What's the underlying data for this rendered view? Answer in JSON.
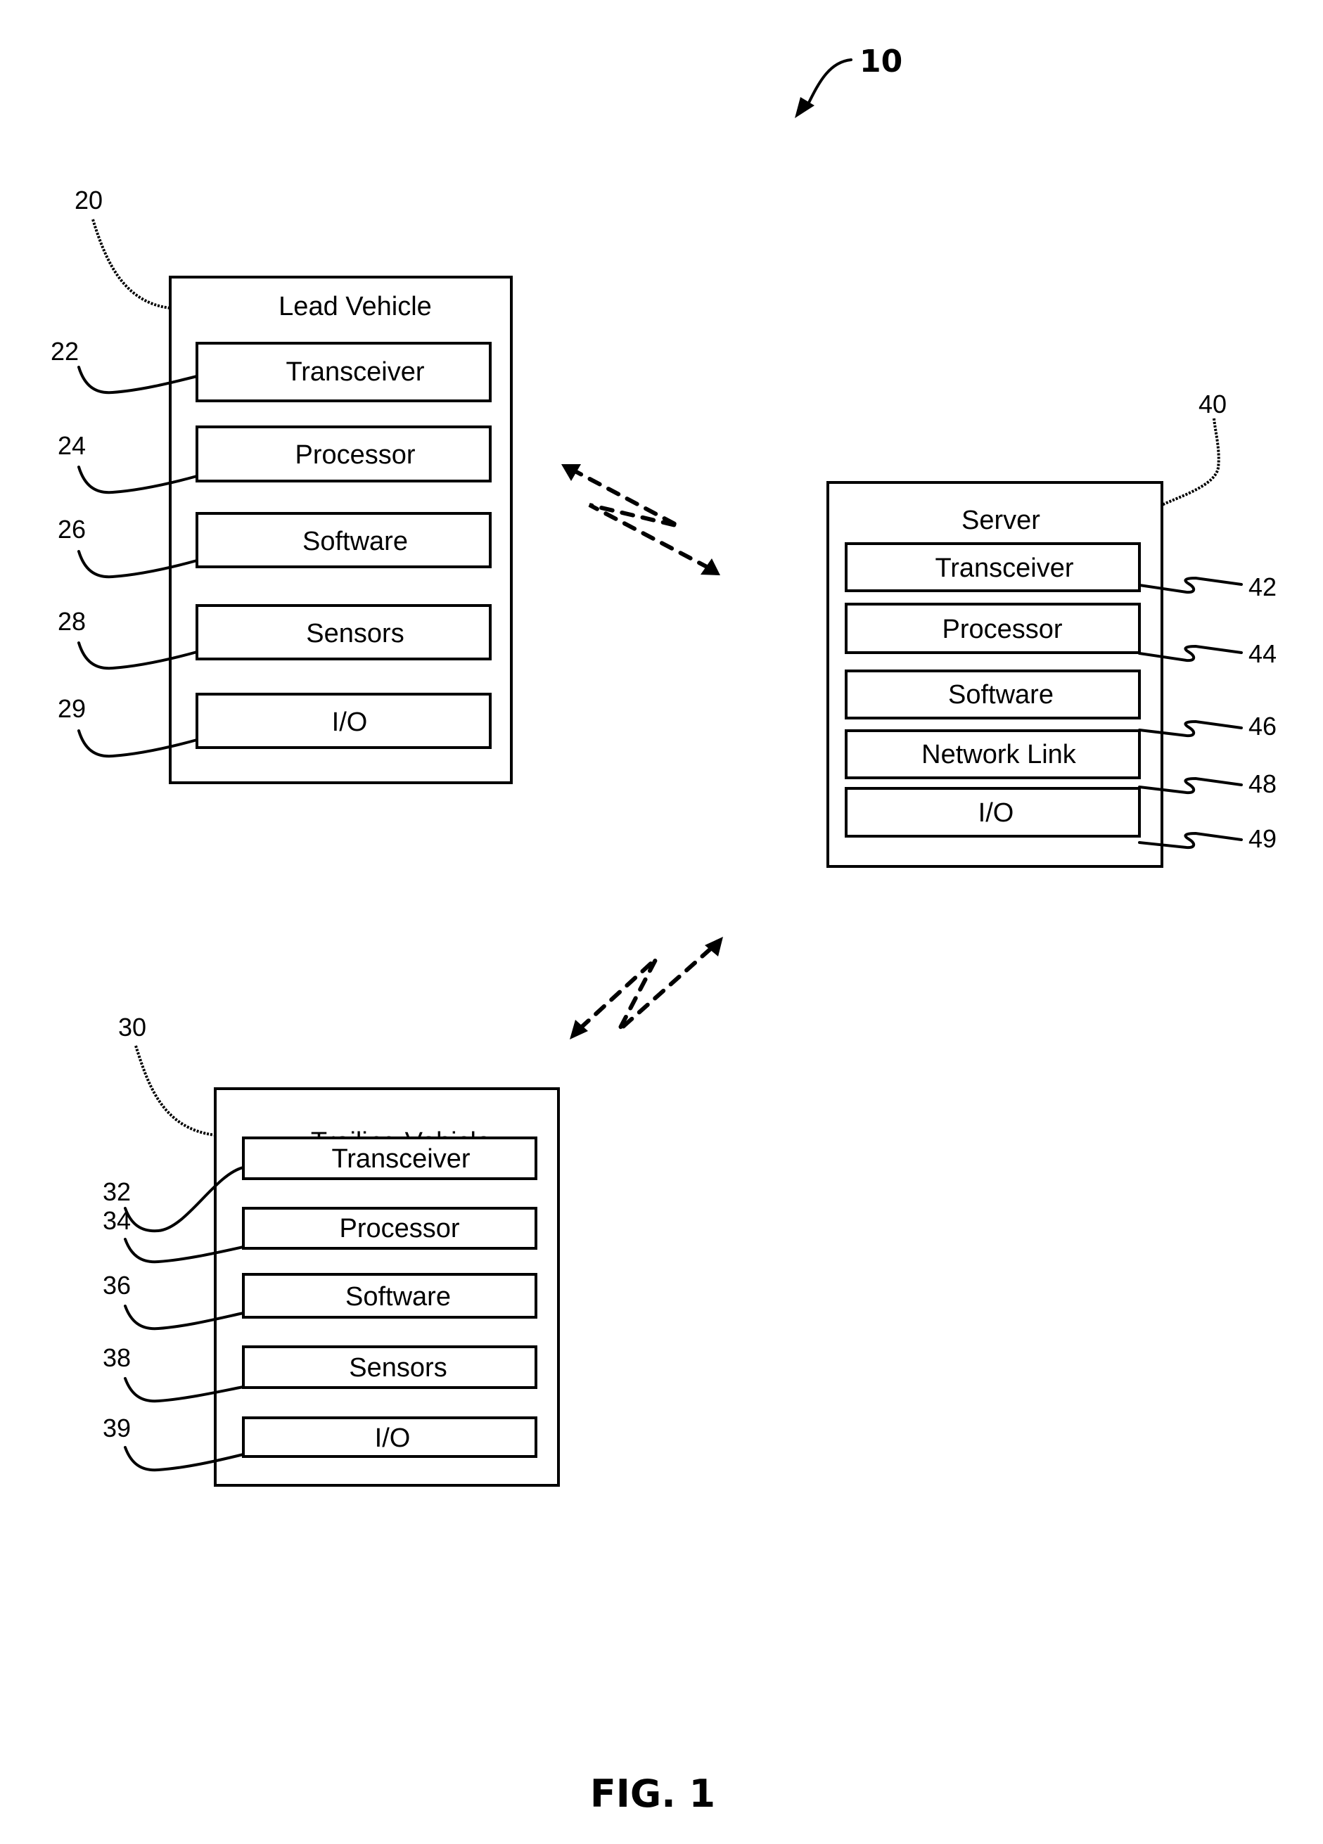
{
  "figure": {
    "caption": "FIG. 1",
    "system_ref": "10"
  },
  "lead_vehicle": {
    "ref": "20",
    "title": "Lead Vehicle",
    "components": [
      {
        "ref": "22",
        "label": "Transceiver"
      },
      {
        "ref": "24",
        "label": "Processor"
      },
      {
        "ref": "26",
        "label": "Software"
      },
      {
        "ref": "28",
        "label": "Sensors"
      },
      {
        "ref": "29",
        "label": "I/O"
      }
    ]
  },
  "server": {
    "ref": "40",
    "title": "Server",
    "components": [
      {
        "ref": "42",
        "label": "Transceiver"
      },
      {
        "ref": "44",
        "label": "Processor"
      },
      {
        "ref": "46",
        "label": "Software"
      },
      {
        "ref": "48",
        "label": "Network Link"
      },
      {
        "ref": "49",
        "label": "I/O"
      }
    ]
  },
  "trailing_vehicle": {
    "ref": "30",
    "title": "Trailing Vehicle",
    "components": [
      {
        "ref": "32",
        "label": "Transceiver"
      },
      {
        "ref": "34",
        "label": "Processor"
      },
      {
        "ref": "36",
        "label": "Software"
      },
      {
        "ref": "38",
        "label": "Sensors"
      },
      {
        "ref": "39",
        "label": "I/O"
      }
    ]
  },
  "links": [
    {
      "from": "lead_vehicle",
      "to": "server",
      "type": "wireless-bidirectional"
    },
    {
      "from": "trailing_vehicle",
      "to": "server",
      "type": "wireless-bidirectional"
    }
  ]
}
